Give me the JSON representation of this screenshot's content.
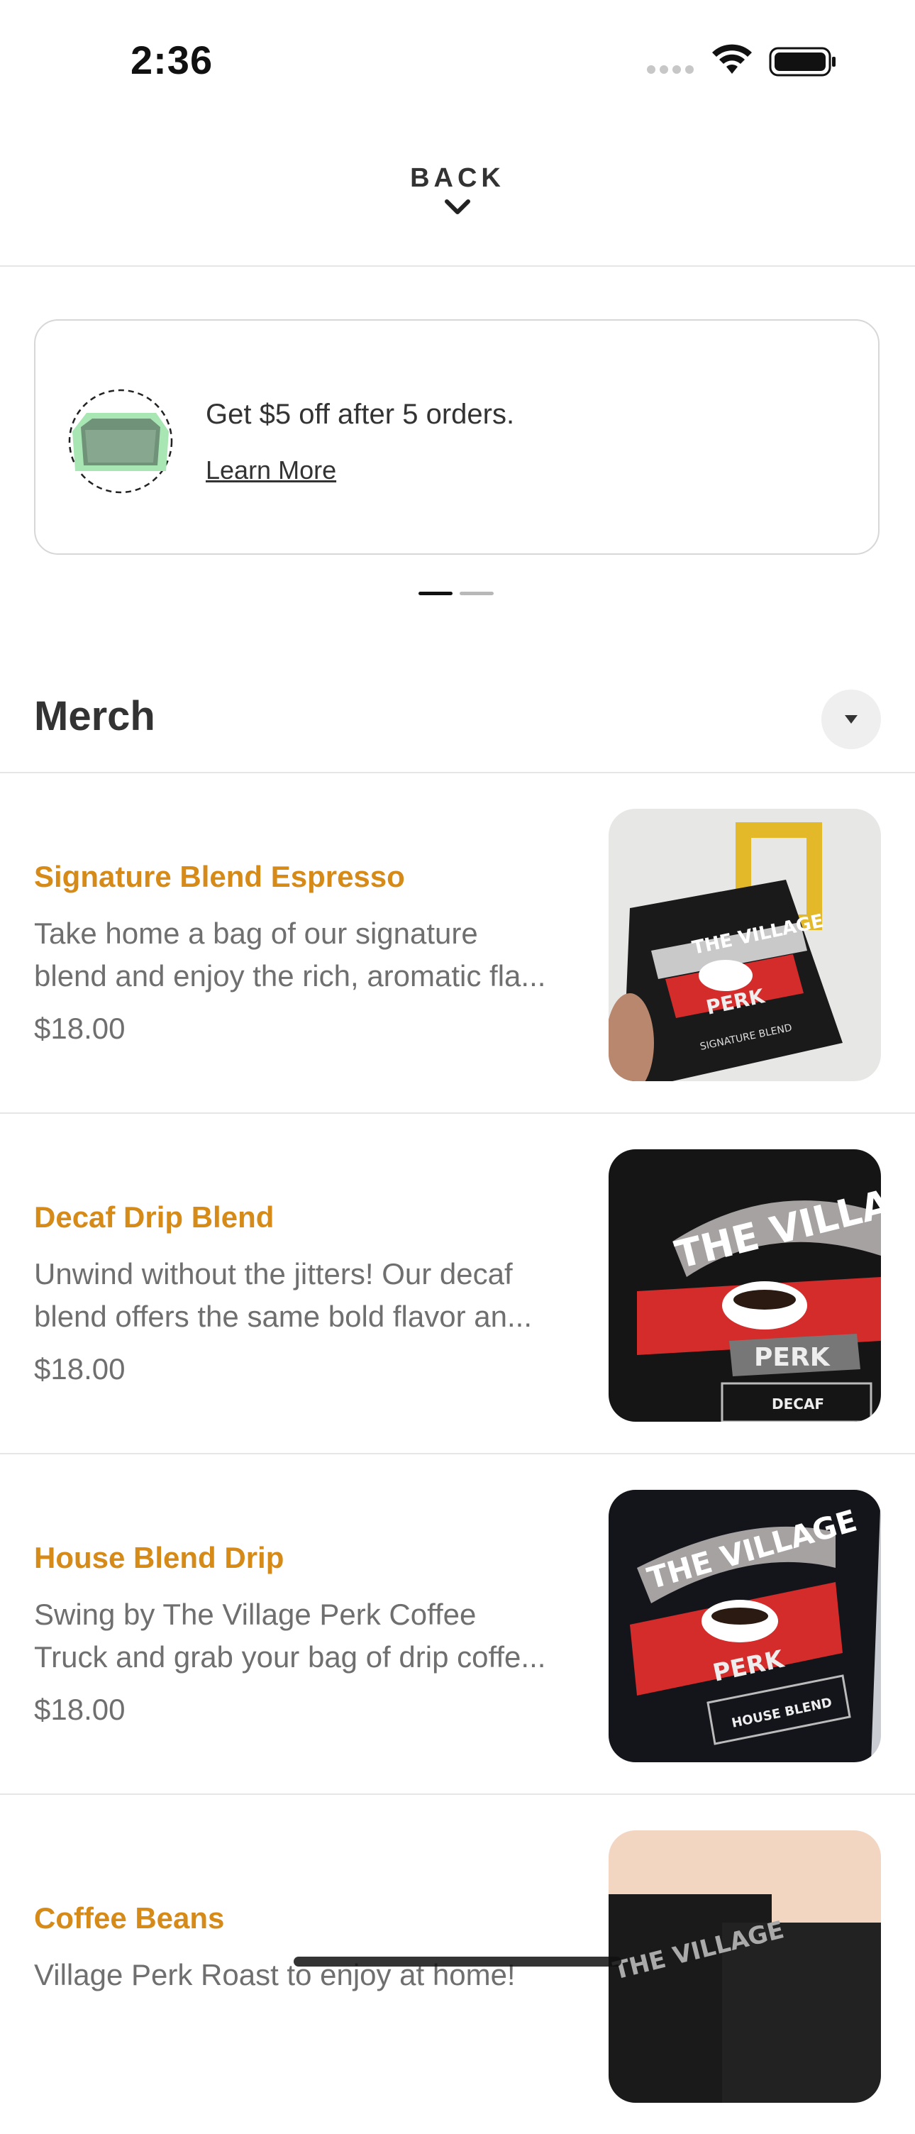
{
  "status_bar": {
    "time": "2:36"
  },
  "header": {
    "back_label": "BACK"
  },
  "promo": {
    "title": "Get $5 off after 5 orders.",
    "link": "Learn More"
  },
  "section": {
    "title": "Merch"
  },
  "items": [
    {
      "name": "Signature Blend Espresso",
      "desc_line1": "Take home a bag of our signature",
      "desc_line2": "blend and enjoy the rich, aromatic fla...",
      "price": "$18.00",
      "bag_label": "SIGNATURE BLEND"
    },
    {
      "name": "Decaf Drip Blend",
      "desc_line1": "Unwind without the jitters! Our decaf",
      "desc_line2": "blend offers the same bold flavor an...",
      "price": "$18.00",
      "bag_label": "DECAF"
    },
    {
      "name": "House Blend Drip",
      "desc_line1": "Swing by The Village Perk Coffee",
      "desc_line2": "Truck and grab your bag of drip coffe...",
      "price": "$18.00",
      "bag_label": "HOUSE BLEND"
    },
    {
      "name": "Coffee Beans",
      "desc_line1": "Village Perk Roast to enjoy at home!",
      "desc_line2": "",
      "price": "",
      "bag_label": ""
    }
  ],
  "brand": {
    "line1": "THE VILLAGE",
    "line2": "PERK"
  },
  "colors": {
    "accent": "#d68a17",
    "text": "#333333",
    "muted": "#6f6f6f",
    "promo_icon_green": "#a8e6b4"
  },
  "icons": {
    "back": "chevron-down-icon",
    "collapse": "caret-down-icon",
    "promo": "punch-card-icon"
  }
}
